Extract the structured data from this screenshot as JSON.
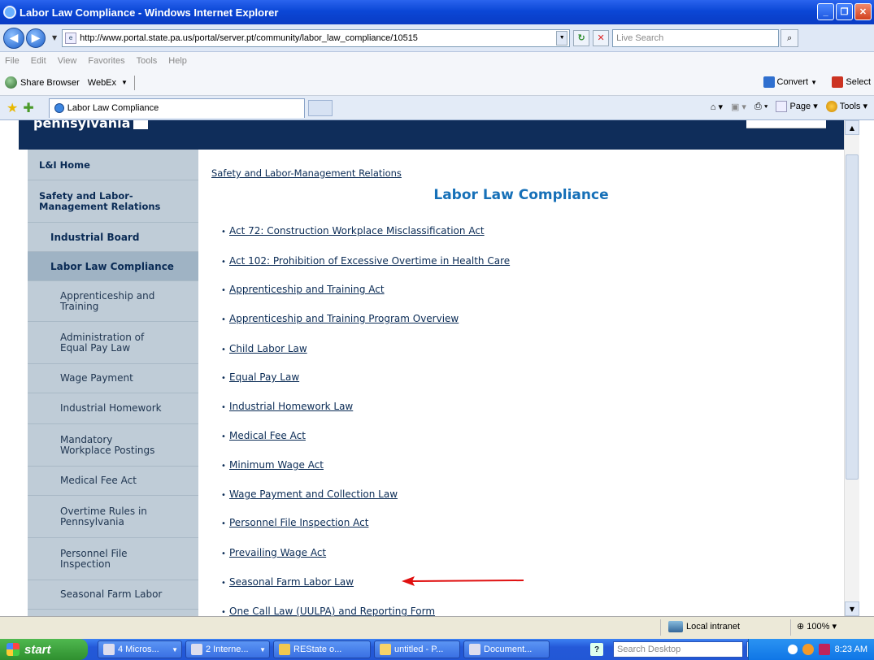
{
  "window": {
    "title": "Labor Law Compliance - Windows Internet Explorer"
  },
  "address_bar": {
    "url": "http://www.portal.state.pa.us/portal/server.pt/community/labor_law_compliance/10515",
    "search_placeholder": "Live Search"
  },
  "menu": [
    "File",
    "Edit",
    "View",
    "Favorites",
    "Tools",
    "Help"
  ],
  "links_bar": {
    "share": "Share Browser",
    "webex": "WebEx",
    "convert": "Convert",
    "select": "Select"
  },
  "tab": {
    "label": "Labor Law Compliance"
  },
  "command_bar": {
    "page": "Page",
    "tools": "Tools"
  },
  "banner": {
    "site": "pennsylvania"
  },
  "sidebar": {
    "items": [
      {
        "label": "L&I Home"
      },
      {
        "label": "Safety and Labor-\nManagement Relations"
      },
      {
        "label": "Industrial Board"
      },
      {
        "label": "Labor Law Compliance"
      },
      {
        "label": "Apprenticeship and\nTraining"
      },
      {
        "label": "Administration of\nEqual Pay Law"
      },
      {
        "label": "Wage Payment"
      },
      {
        "label": "Industrial Homework"
      },
      {
        "label": "Mandatory\nWorkplace Postings"
      },
      {
        "label": "Medical Fee Act"
      },
      {
        "label": "Overtime Rules in\nPennsylvania"
      },
      {
        "label": "Personnel File\nInspection"
      },
      {
        "label": "Seasonal Farm Labor"
      }
    ]
  },
  "main": {
    "breadcrumb": "Safety and Labor-Management Relations",
    "title": "Labor Law Compliance",
    "links": [
      "Act 72: Construction Workplace Misclassification Act",
      "Act 102: Prohibition of Excessive Overtime in Health Care",
      "Apprenticeship and Training Act",
      "Apprenticeship and Training Program Overview",
      "Child Labor Law",
      "Equal Pay Law",
      "Industrial Homework Law",
      "Medical Fee Act",
      "Minimum Wage Act",
      "Wage Payment and Collection Law",
      "Personnel File Inspection Act",
      "Prevailing Wage Act",
      "Seasonal Farm Labor Law",
      "One Call Law (UULPA) and Reporting Form"
    ]
  },
  "status_bar": {
    "zone": "Local intranet",
    "zoom": "100%"
  },
  "taskbar": {
    "start": "start",
    "tasks": [
      "4 Micros...",
      "2 Interne...",
      "REState o...",
      "untitled - P...",
      "Document..."
    ],
    "search_placeholder": "Search Desktop",
    "clock": "8:23 AM"
  },
  "colors": {
    "banner": "#0f2d5a",
    "sidebar": "#bfccd7",
    "title": "#1670b8",
    "arrow": "#e01010"
  }
}
